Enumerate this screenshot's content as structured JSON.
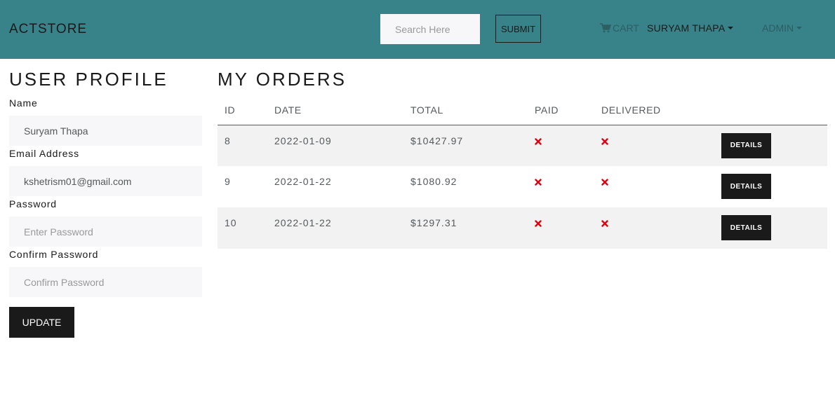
{
  "navbar": {
    "brand": "ACTSTORE",
    "search_placeholder": "Search Here",
    "submit_label": "SUBMIT",
    "cart_label": "CART",
    "user_label": "SURYAM THAPA",
    "admin_label": "ADMIN"
  },
  "profile": {
    "title": "USER PROFILE",
    "name_label": "Name",
    "name_value": "Suryam Thapa",
    "email_label": "Email Address",
    "email_value": "kshetrism01@gmail.com",
    "password_label": "Password",
    "password_placeholder": "Enter Password",
    "confirm_label": "Confirm Password",
    "confirm_placeholder": "Confirm Password",
    "update_label": "UPDATE"
  },
  "orders": {
    "title": "MY ORDERS",
    "columns": [
      "ID",
      "DATE",
      "TOTAL",
      "PAID",
      "DELIVERED"
    ],
    "rows": [
      {
        "id": "8",
        "date": "2022-01-09",
        "total": "$10427.97",
        "paid": "x-icon",
        "delivered": "x-icon",
        "details": "DETAILS"
      },
      {
        "id": "9",
        "date": "2022-01-22",
        "total": "$1080.92",
        "paid": "x-icon",
        "delivered": "x-icon",
        "details": "DETAILS"
      },
      {
        "id": "10",
        "date": "2022-01-22",
        "total": "$1297.31",
        "paid": "x-icon",
        "delivered": "x-icon",
        "details": "DETAILS"
      }
    ]
  },
  "colors": {
    "navbar_bg": "#378389",
    "status_no": "#e0000f",
    "button_dark": "#1a1a1a"
  }
}
